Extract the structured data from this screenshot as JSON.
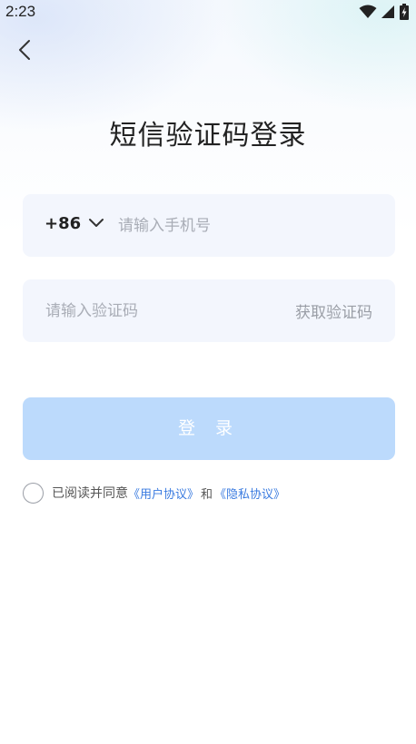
{
  "status_bar": {
    "time": "2:23",
    "icons": [
      "wifi-icon",
      "signal-icon",
      "battery-icon"
    ]
  },
  "header": {
    "back_icon": "chevron-left-icon",
    "title": "短信验证码登录"
  },
  "phone_field": {
    "country_code": "+86",
    "dropdown_icon": "chevron-down-icon",
    "placeholder": "请输入手机号",
    "value": ""
  },
  "code_field": {
    "placeholder": "请输入验证码",
    "value": "",
    "get_code_label": "获取验证码"
  },
  "login_button": {
    "label": "登 录"
  },
  "agreement": {
    "checked": false,
    "prefix": "已阅读并同意",
    "user_agreement_link": "《用户协议》",
    "and_text": "和",
    "privacy_link": "《隐私协议》"
  },
  "colors": {
    "accent": "#3a7be0",
    "button_disabled": "#bcdafc",
    "field_bg": "#f3f6fd"
  }
}
